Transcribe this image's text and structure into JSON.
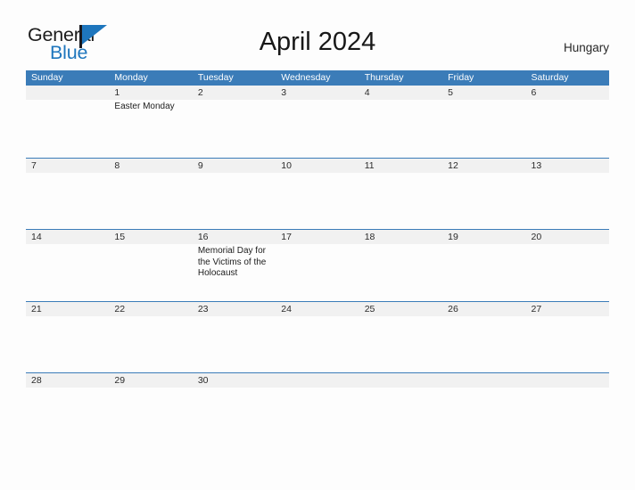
{
  "brand": {
    "name_part1": "General",
    "name_part2": "Blue",
    "flag_icon": "flag-icon",
    "primary_color": "#1e76bd"
  },
  "header": {
    "title": "April 2024",
    "country": "Hungary"
  },
  "theme": {
    "header_bg": "#3b7cb8",
    "band_bg": "#f1f1f1",
    "grid_line": "#3b7cb8",
    "page_bg": "#fdfdfd",
    "text": "#1d1d1d"
  },
  "calendar": {
    "weekdays": [
      "Sunday",
      "Monday",
      "Tuesday",
      "Wednesday",
      "Thursday",
      "Friday",
      "Saturday"
    ],
    "weeks": [
      [
        {
          "date": "",
          "events": []
        },
        {
          "date": "1",
          "events": [
            "Easter Monday"
          ]
        },
        {
          "date": "2",
          "events": []
        },
        {
          "date": "3",
          "events": []
        },
        {
          "date": "4",
          "events": []
        },
        {
          "date": "5",
          "events": []
        },
        {
          "date": "6",
          "events": []
        }
      ],
      [
        {
          "date": "7",
          "events": []
        },
        {
          "date": "8",
          "events": []
        },
        {
          "date": "9",
          "events": []
        },
        {
          "date": "10",
          "events": []
        },
        {
          "date": "11",
          "events": []
        },
        {
          "date": "12",
          "events": []
        },
        {
          "date": "13",
          "events": []
        }
      ],
      [
        {
          "date": "14",
          "events": []
        },
        {
          "date": "15",
          "events": []
        },
        {
          "date": "16",
          "events": [
            "Memorial Day for the Victims of the Holocaust"
          ]
        },
        {
          "date": "17",
          "events": []
        },
        {
          "date": "18",
          "events": []
        },
        {
          "date": "19",
          "events": []
        },
        {
          "date": "20",
          "events": []
        }
      ],
      [
        {
          "date": "21",
          "events": []
        },
        {
          "date": "22",
          "events": []
        },
        {
          "date": "23",
          "events": []
        },
        {
          "date": "24",
          "events": []
        },
        {
          "date": "25",
          "events": []
        },
        {
          "date": "26",
          "events": []
        },
        {
          "date": "27",
          "events": []
        }
      ],
      [
        {
          "date": "28",
          "events": []
        },
        {
          "date": "29",
          "events": []
        },
        {
          "date": "30",
          "events": []
        },
        {
          "date": "",
          "events": []
        },
        {
          "date": "",
          "events": []
        },
        {
          "date": "",
          "events": []
        },
        {
          "date": "",
          "events": []
        }
      ]
    ]
  }
}
